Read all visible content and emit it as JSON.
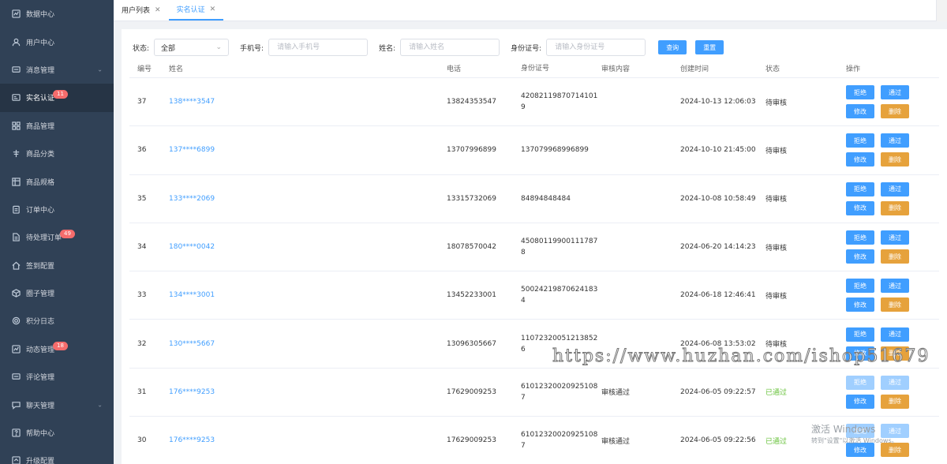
{
  "sidebar": {
    "items": [
      {
        "label": "数据中心",
        "icon": "chart-icon"
      },
      {
        "label": "用户中心",
        "icon": "user-icon"
      },
      {
        "label": "消息管理",
        "icon": "message-icon",
        "expandable": true
      },
      {
        "label": "实名认证",
        "icon": "id-card-icon",
        "badge": "11",
        "active": true
      },
      {
        "label": "商品管理",
        "icon": "grid-icon"
      },
      {
        "label": "商品分类",
        "icon": "category-icon"
      },
      {
        "label": "商品规格",
        "icon": "table-icon"
      },
      {
        "label": "订单中心",
        "icon": "clipboard-icon"
      },
      {
        "label": "待处理订单",
        "icon": "document-icon",
        "badge": "49"
      },
      {
        "label": "签到配置",
        "icon": "home-icon"
      },
      {
        "label": "圈子管理",
        "icon": "box-icon"
      },
      {
        "label": "积分日志",
        "icon": "gear-icon"
      },
      {
        "label": "动态管理",
        "icon": "chart-icon",
        "badge": "18"
      },
      {
        "label": "评论管理",
        "icon": "message-icon"
      },
      {
        "label": "聊天管理",
        "icon": "chat-icon",
        "expandable": true
      },
      {
        "label": "帮助中心",
        "icon": "help-icon"
      },
      {
        "label": "升级配置",
        "icon": "upgrade-icon"
      }
    ]
  },
  "tabs": [
    {
      "label": "用户列表",
      "active": false
    },
    {
      "label": "实名认证",
      "active": true
    }
  ],
  "filters": {
    "status_label": "状态:",
    "status_value": "全部",
    "phone_label": "手机号:",
    "phone_placeholder": "请输入手机号",
    "name_label": "姓名:",
    "name_placeholder": "请输入姓名",
    "idcard_label": "身份证号:",
    "idcard_placeholder": "请输入身份证号",
    "search_btn": "查询",
    "reset_btn": "重置"
  },
  "table": {
    "headers": {
      "id": "编号",
      "name": "姓名",
      "phone": "电话",
      "idcard": "身份证号",
      "audit": "审核内容",
      "time": "创建时间",
      "status": "状态",
      "ops": "操作"
    },
    "op_labels": {
      "reject": "拒绝",
      "approve": "通过",
      "edit": "修改",
      "delete": "删除"
    },
    "rows": [
      {
        "id": "37",
        "name": "138****3547",
        "phone": "13824353547",
        "idcard": "420821198707141019",
        "audit": "",
        "time": "2024-10-13 12:06:03",
        "status": "待审核",
        "approved": false
      },
      {
        "id": "36",
        "name": "137****6899",
        "phone": "13707996899",
        "idcard": "137079968996899",
        "audit": "",
        "time": "2024-10-10 21:45:00",
        "status": "待审核",
        "approved": false
      },
      {
        "id": "35",
        "name": "133****2069",
        "phone": "13315732069",
        "idcard": "84894848484",
        "audit": "",
        "time": "2024-10-08 10:58:49",
        "status": "待审核",
        "approved": false
      },
      {
        "id": "34",
        "name": "180****0042",
        "phone": "18078570042",
        "idcard": "450801199001117878",
        "audit": "",
        "time": "2024-06-20 14:14:23",
        "status": "待审核",
        "approved": false
      },
      {
        "id": "33",
        "name": "134****3001",
        "phone": "13452233001",
        "idcard": "500242198706241834",
        "audit": "",
        "time": "2024-06-18 12:46:41",
        "status": "待审核",
        "approved": false
      },
      {
        "id": "32",
        "name": "130****5667",
        "phone": "13096305667",
        "idcard": "110723200512138526",
        "audit": "",
        "time": "2024-06-08 13:53:02",
        "status": "待审核",
        "approved": false
      },
      {
        "id": "31",
        "name": "176****9253",
        "phone": "17629009253",
        "idcard": "610123200209251087",
        "audit": "审核通过",
        "time": "2024-06-05 09:22:57",
        "status": "已通过",
        "approved": true
      },
      {
        "id": "30",
        "name": "176****9253",
        "phone": "17629009253",
        "idcard": "610123200209251087",
        "audit": "审核通过",
        "time": "2024-06-05 09:22:56",
        "status": "已通过",
        "approved": true
      }
    ]
  },
  "overlays": {
    "watermark": "https://www.huzhan.com/ishop51679",
    "windows_activate": "激活 Windows",
    "windows_activate_sub": "转到\"设置\"以激活 Windows。"
  },
  "colors": {
    "sidebar_bg": "#304156",
    "primary": "#409eff",
    "warning": "#e6a23c",
    "success": "#67c23a",
    "badge": "#f56c6c"
  }
}
